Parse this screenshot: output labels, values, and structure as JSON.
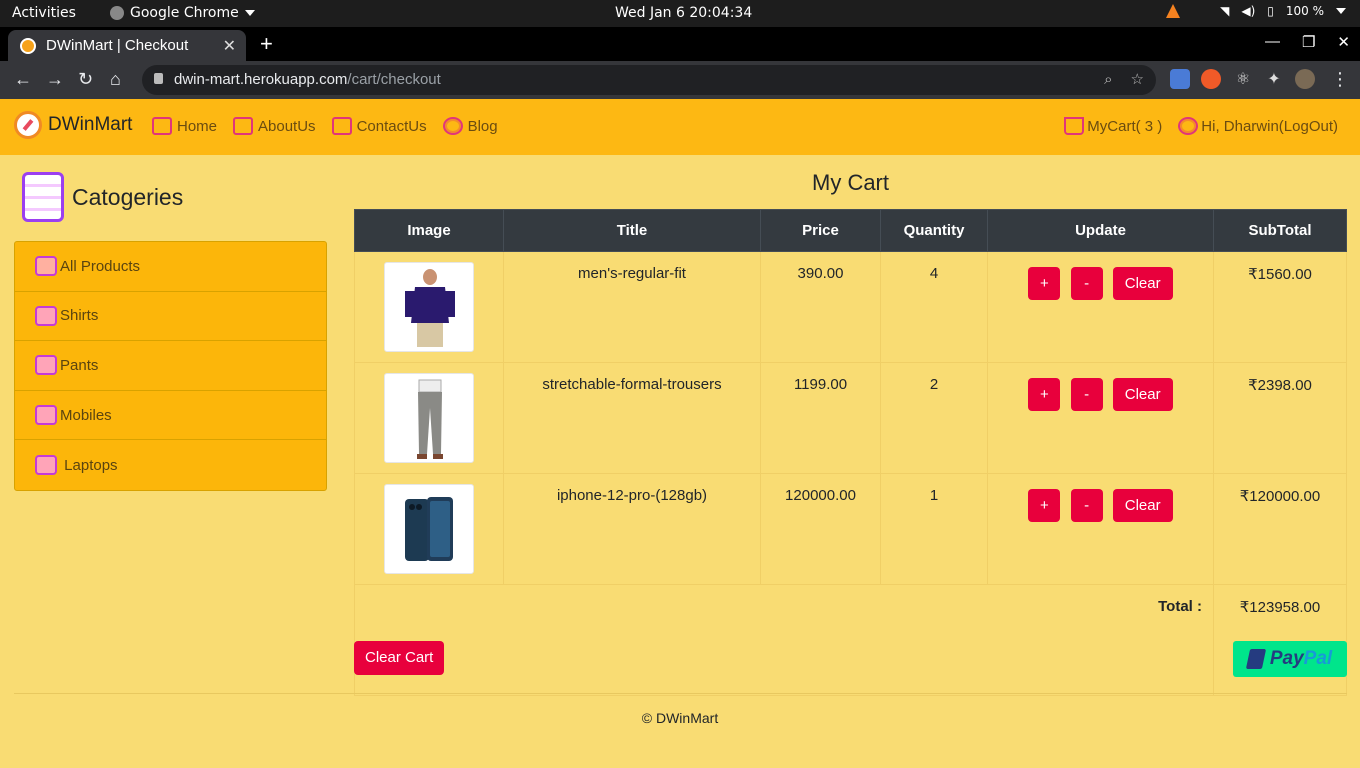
{
  "system": {
    "activities": "Activities",
    "app_name": "Google Chrome",
    "clock": "Wed Jan 6  20:04:34",
    "battery": "100 %"
  },
  "browser": {
    "tab_title": "DWinMart | Checkout",
    "url_host": "dwin-mart.herokuapp.com",
    "url_path": "/cart/checkout"
  },
  "site": {
    "brand": "DWinMart",
    "nav": [
      "Home",
      "AboutUs",
      "ContactUs",
      "Blog"
    ],
    "cart_link": "MyCart( 3 )",
    "user_link": "Hi, Dharwin(LogOut)"
  },
  "sidebar": {
    "title": "Catogeries",
    "items": [
      "All Products",
      "Shirts",
      "Pants",
      "Mobiles",
      " Laptops"
    ]
  },
  "cart": {
    "title": "My Cart",
    "columns": [
      "Image",
      "Title",
      "Price",
      "Quantity",
      "Update",
      "SubTotal"
    ],
    "rows": [
      {
        "title": "men's-regular-fit",
        "price": "390.00",
        "qty": "4",
        "subtotal": "₹1560.00"
      },
      {
        "title": "stretchable-formal-trousers",
        "price": "1199.00",
        "qty": "2",
        "subtotal": "₹2398.00"
      },
      {
        "title": "iphone-12-pro-(128gb)",
        "price": "120000.00",
        "qty": "1",
        "subtotal": "₹120000.00"
      }
    ],
    "btn_plus": "+",
    "btn_minus": "-",
    "btn_clear": "Clear",
    "total_label": "Total :",
    "total_value": "₹123958.00",
    "clear_cart": "Clear Cart",
    "paypal_a": "Pay",
    "paypal_b": "Pal"
  },
  "footer": "© DWinMart",
  "colors": {
    "navbar": "#fdb813",
    "page_bg": "#f9dc73",
    "danger": "#e8003c",
    "table_head": "#343a40",
    "paypal": "#00e58b"
  }
}
